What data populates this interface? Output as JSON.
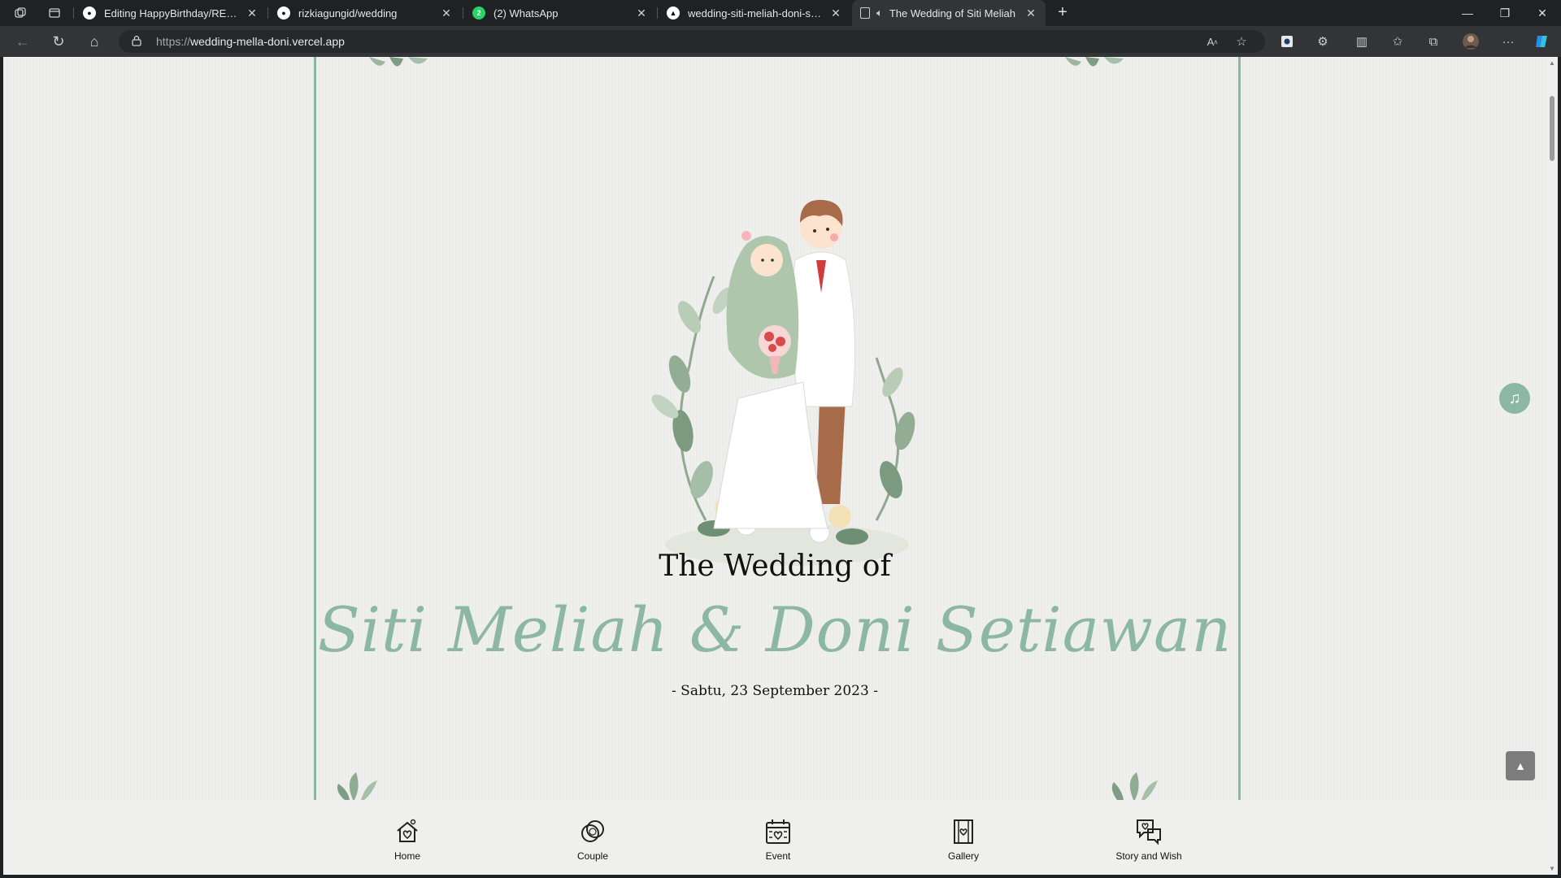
{
  "browser": {
    "tabs": [
      {
        "title": "Editing HappyBirthday/README",
        "icon": "github-icon",
        "active": false
      },
      {
        "title": "rizkiagungid/wedding",
        "icon": "github-icon",
        "active": false
      },
      {
        "title": "(2) WhatsApp",
        "icon": "whatsapp-icon",
        "active": false
      },
      {
        "title": "wedding-siti-meliah-doni-setiaw",
        "icon": "vercel-icon",
        "active": false
      },
      {
        "title": "The Wedding of Siti Meliah",
        "icon": "page-icon",
        "active": true
      }
    ],
    "url_protocol": "https://",
    "url_host": "wedding-mella-doni.vercel.app"
  },
  "page": {
    "subtitle": "The Wedding of",
    "names": "Siti Meliah & Doni Setiawan",
    "date": "- Sabtu, 23 September 2023 -",
    "accent_color": "#8cb6a6"
  },
  "nav": {
    "items": [
      {
        "label": "Home",
        "icon": "home-icon"
      },
      {
        "label": "Couple",
        "icon": "rings-icon"
      },
      {
        "label": "Event",
        "icon": "calendar-icon"
      },
      {
        "label": "Gallery",
        "icon": "gallery-icon"
      },
      {
        "label": "Story and Wish",
        "icon": "chat-heart-icon"
      }
    ]
  },
  "floating": {
    "music_icon": "music-note-icon",
    "scroll_top_icon": "chevron-up-icon"
  }
}
